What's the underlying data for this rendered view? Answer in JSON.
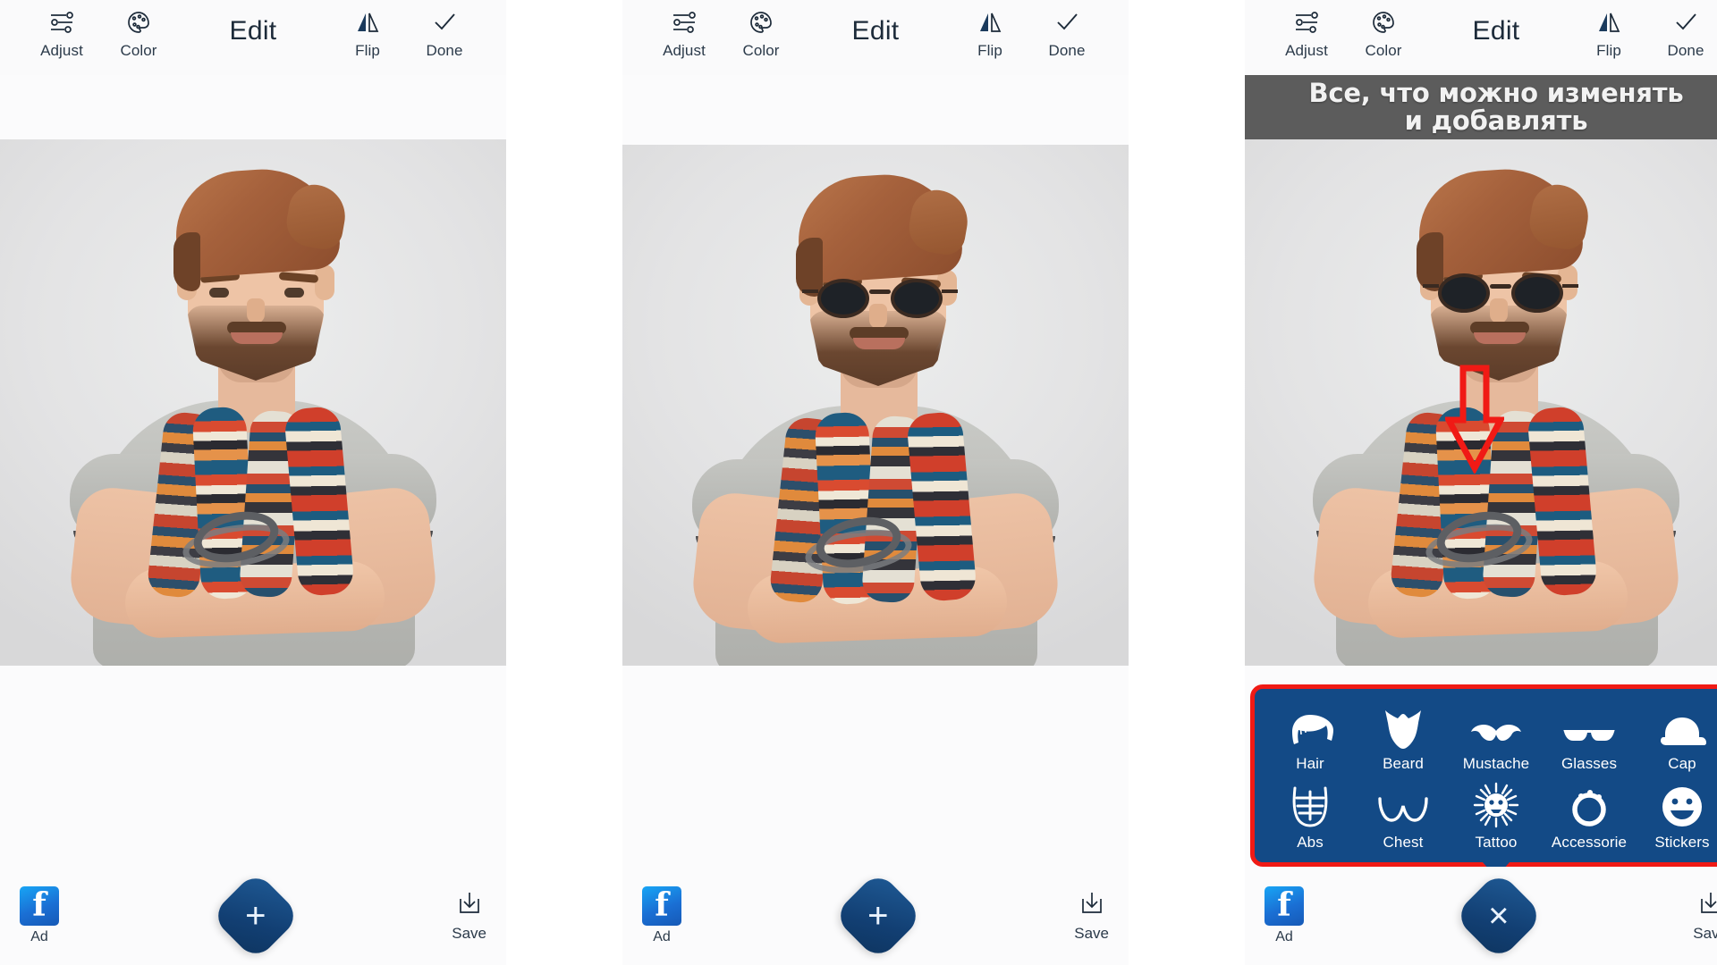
{
  "app": {
    "title": "Edit"
  },
  "toolbar": {
    "adjust_label": "Adjust",
    "color_label": "Color",
    "title": "Edit",
    "flip_label": "Flip",
    "done_label": "Done"
  },
  "bottom_bar": {
    "ad_label": "Ad",
    "ad_icon": "facebook-icon",
    "fab_add_glyph": "+",
    "fab_close_glyph": "×",
    "save_label": "Save",
    "save_icon": "download-icon"
  },
  "promo": {
    "line1": "Все, что можно изменять",
    "line2": "и добавлять",
    "background": "#5c5c5c",
    "text_color": "#f2f2f2"
  },
  "options_panel": {
    "background": "#134a86",
    "border_color": "#f01a15",
    "rows": [
      [
        {
          "label": "Hair",
          "icon": "hair-icon"
        },
        {
          "label": "Beard",
          "icon": "beard-icon"
        },
        {
          "label": "Mustache",
          "icon": "mustache-icon"
        },
        {
          "label": "Glasses",
          "icon": "glasses-icon"
        },
        {
          "label": "Cap",
          "icon": "cap-icon"
        }
      ],
      [
        {
          "label": "Abs",
          "icon": "abs-icon"
        },
        {
          "label": "Chest",
          "icon": "chest-icon"
        },
        {
          "label": "Tattoo",
          "icon": "tattoo-icon"
        },
        {
          "label": "Accessorie",
          "icon": "accessorie-icon"
        },
        {
          "label": "Stickers",
          "icon": "stickers-icon"
        }
      ]
    ]
  },
  "annotation": {
    "arrow_color": "#f01a15",
    "arrow_direction": "down"
  },
  "panels": [
    {
      "id": "panel-1",
      "state": "original-portrait",
      "has_sunglasses": false,
      "has_promo": false,
      "has_options": false,
      "fab": "+"
    },
    {
      "id": "panel-2",
      "state": "sunglasses-applied",
      "has_sunglasses": true,
      "has_promo": false,
      "has_options": false,
      "fab": "+"
    },
    {
      "id": "panel-3",
      "state": "options-open",
      "has_sunglasses": true,
      "has_promo": true,
      "has_options": true,
      "fab": "×"
    }
  ],
  "colors": {
    "toolbar_bg": "#fafafb",
    "label_text": "#2b3a4a",
    "accent_blue": "#134a86",
    "accent_red": "#f01a15",
    "photo_bg": "#e2e2e3"
  }
}
